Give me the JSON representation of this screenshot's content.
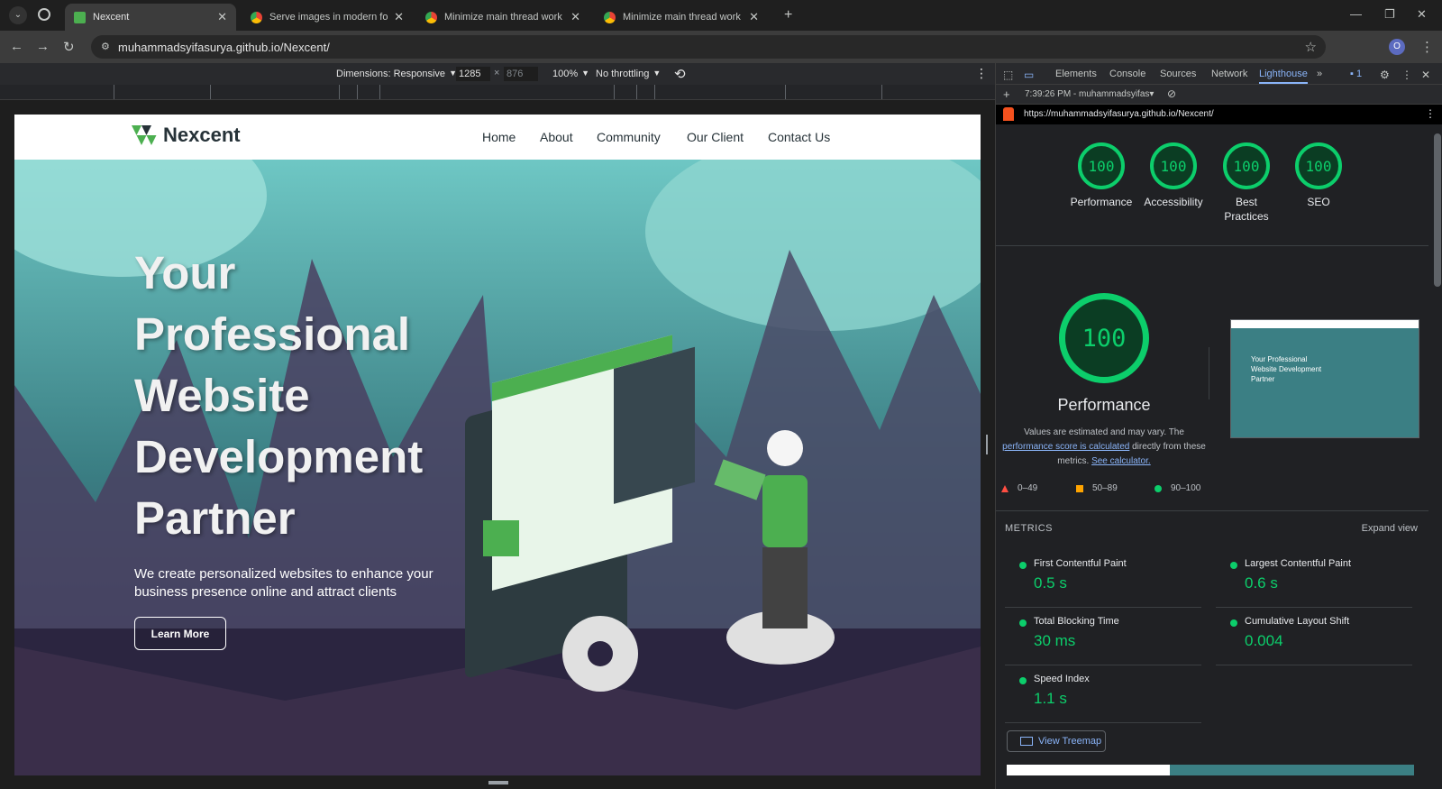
{
  "browser": {
    "tabs": [
      {
        "title": "Nexcent",
        "favicon_color": "#4caf50",
        "active": true
      },
      {
        "title": "Serve images in modern format",
        "favicon_color": "#4285f4",
        "active": false
      },
      {
        "title": "Minimize main thread work | L",
        "favicon_color": "#4285f4",
        "active": false
      },
      {
        "title": "Minimize main thread work | L",
        "favicon_color": "#4285f4",
        "active": false
      }
    ],
    "new_tab_symbol": "+",
    "url": "muhammadsyifasurya.github.io/Nexcent/",
    "profile_initial": "O"
  },
  "device_toolbar": {
    "dimensions_label": "Dimensions: Responsive",
    "width": "1285",
    "height": "876",
    "zoom": "100%",
    "throttling": "No throttling"
  },
  "site": {
    "brand": "Nexcent",
    "nav": [
      "Home",
      "About",
      "Community",
      "Our Client",
      "Contact Us"
    ],
    "hero_title_lines": [
      "Your",
      "Professional",
      "Website",
      "Development",
      "Partner"
    ],
    "hero_subtitle": "We create personalized websites to enhance your business presence online and attract clients",
    "cta_label": "Learn More"
  },
  "devtools": {
    "tabs": [
      "Elements",
      "Console",
      "Sources",
      "Network",
      "Lighthouse"
    ],
    "active_tab": "Lighthouse",
    "issues_count": "1",
    "report_time": "7:39:26 PM - muhammadsyifas",
    "report_url": "https://muhammadsyifasurya.github.io/Nexcent/",
    "scores": [
      {
        "label": "Performance",
        "value": "100"
      },
      {
        "label": "Accessibility",
        "value": "100"
      },
      {
        "label": "Best Practices",
        "value": "100"
      },
      {
        "label": "SEO",
        "value": "100"
      }
    ],
    "performance": {
      "score": "100",
      "title": "Performance",
      "note_prefix": "Values are estimated and may vary. The",
      "note_link": "performance score is calculated",
      "note_mid": "directly from these metrics.",
      "note_link2": "See calculator."
    },
    "legend": [
      {
        "range": "0–49",
        "color": "#ff4e42",
        "shape": "triangle"
      },
      {
        "range": "50–89",
        "color": "#ffa400",
        "shape": "square"
      },
      {
        "range": "90–100",
        "color": "#0cce6b",
        "shape": "circle"
      }
    ],
    "metrics_header": "METRICS",
    "expand_label": "Expand view",
    "metrics": [
      {
        "name": "First Contentful Paint",
        "value": "0.5 s"
      },
      {
        "name": "Largest Contentful Paint",
        "value": "0.6 s"
      },
      {
        "name": "Total Blocking Time",
        "value": "30 ms"
      },
      {
        "name": "Cumulative Layout Shift",
        "value": "0.004"
      },
      {
        "name": "Speed Index",
        "value": "1.1 s"
      }
    ],
    "treemap_label": "View Treemap",
    "thumbnail_text": "Your Professional Website Development Partner"
  }
}
